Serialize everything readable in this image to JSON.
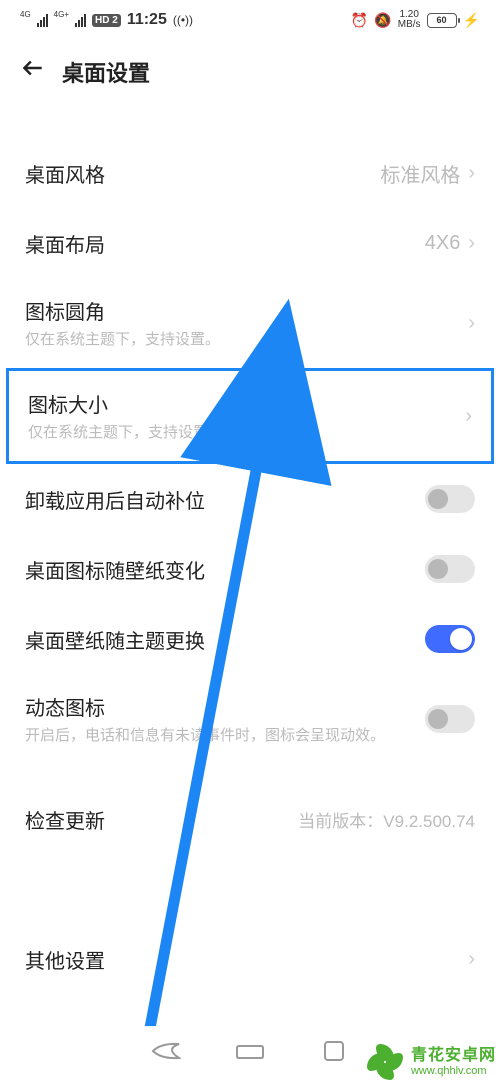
{
  "status": {
    "sig1_label": "4G",
    "sig2_label": "4G+",
    "hd": "HD 2",
    "time": "11:25",
    "net_speed_top": "1.20",
    "net_speed_bot": "MB/s",
    "battery": "60"
  },
  "header": {
    "title": "桌面设置"
  },
  "rows": {
    "style": {
      "title": "桌面风格",
      "value": "标准风格"
    },
    "layout": {
      "title": "桌面布局",
      "value": "4X6"
    },
    "corner": {
      "title": "图标圆角",
      "sub": "仅在系统主题下，支持设置。"
    },
    "size": {
      "title": "图标大小",
      "sub": "仅在系统主题下，支持设置。"
    },
    "autofill": {
      "title": "卸载应用后自动补位"
    },
    "wallpaper": {
      "title": "桌面图标随壁纸变化"
    },
    "theme": {
      "title": "桌面壁纸随主题更换"
    },
    "dynamic": {
      "title": "动态图标",
      "sub": "开启后，电话和信息有未读事件时，图标会呈现动效。"
    },
    "update": {
      "title": "检查更新",
      "value": "当前版本：V9.2.500.74"
    },
    "other": {
      "title": "其他设置"
    }
  },
  "watermark": {
    "cn": "青花安卓网",
    "url": "www.qhhlv.com"
  }
}
